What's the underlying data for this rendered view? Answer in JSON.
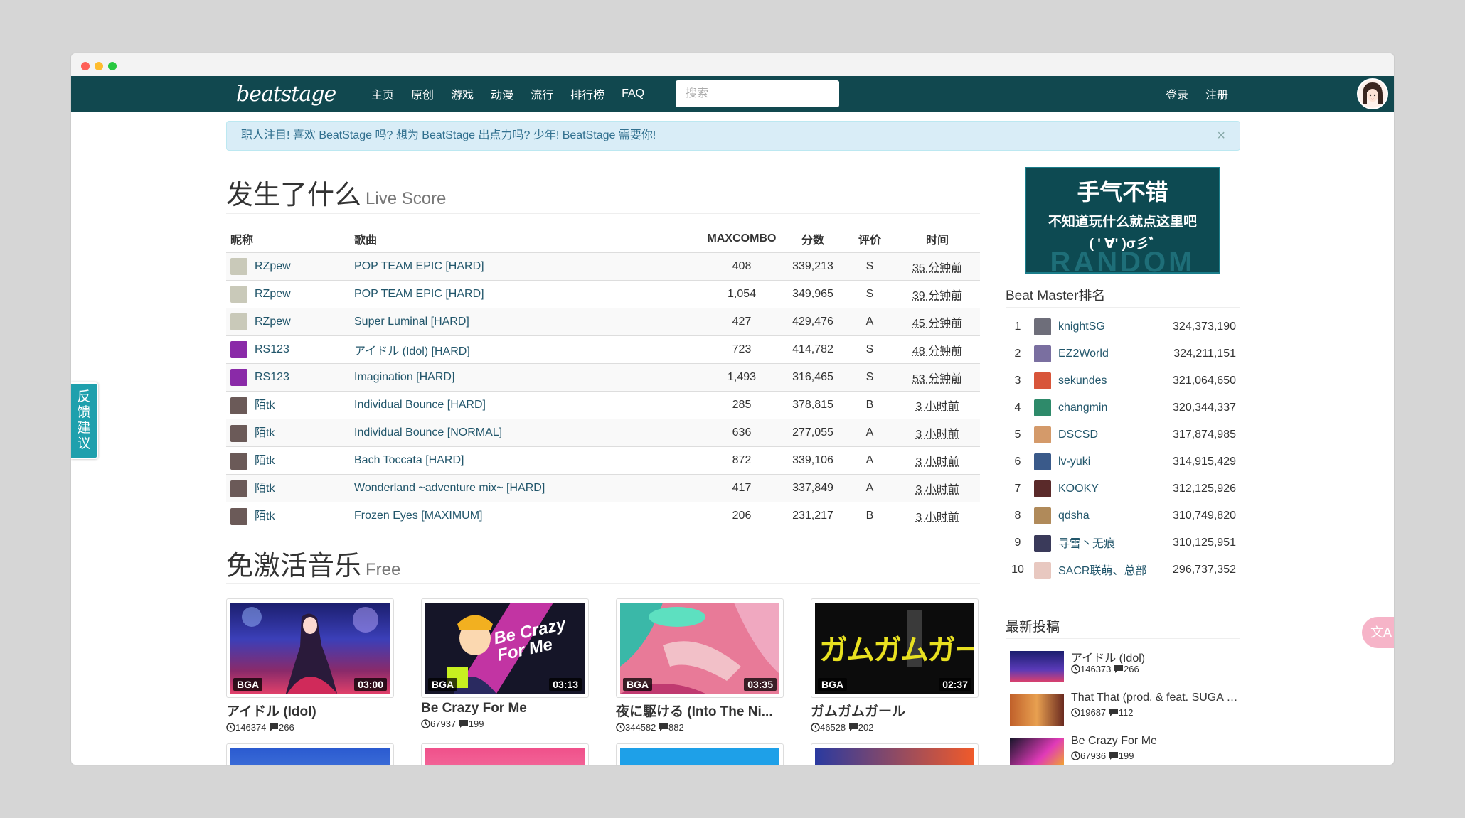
{
  "nav": {
    "logo": "beatstage",
    "items": [
      "主页",
      "原创",
      "游戏",
      "动漫",
      "流行",
      "排行榜",
      "FAQ"
    ],
    "search_placeholder": "搜索",
    "login": "登录",
    "register": "注册"
  },
  "alert": {
    "text": "职人注目! 喜欢 BeatStage 吗? 想为 BeatStage 出点力吗? 少年! BeatStage 需要你!",
    "close": "×"
  },
  "live": {
    "title": "发生了什么",
    "subtitle": "Live Score",
    "headers": [
      "昵称",
      "歌曲",
      "MAXCOMBO",
      "分数",
      "评价",
      "时间"
    ],
    "rows": [
      {
        "user": "RZpew",
        "song": "POP TEAM EPIC [HARD]",
        "combo": "408",
        "score": "339,213",
        "grade": "S",
        "time": "35 分钟前",
        "avatar": "#c9c9b9"
      },
      {
        "user": "RZpew",
        "song": "POP TEAM EPIC [HARD]",
        "combo": "1,054",
        "score": "349,965",
        "grade": "S",
        "time": "39 分钟前",
        "avatar": "#c9c9b9"
      },
      {
        "user": "RZpew",
        "song": "Super Luminal [HARD]",
        "combo": "427",
        "score": "429,476",
        "grade": "A",
        "time": "45 分钟前",
        "avatar": "#c9c9b9"
      },
      {
        "user": "RS123",
        "song": "アイドル (Idol) [HARD]",
        "combo": "723",
        "score": "414,782",
        "grade": "S",
        "time": "48 分钟前",
        "avatar": "#8a2aa8"
      },
      {
        "user": "RS123",
        "song": "Imagination [HARD]",
        "combo": "1,493",
        "score": "316,465",
        "grade": "S",
        "time": "53 分钟前",
        "avatar": "#8a2aa8"
      },
      {
        "user": "陌tk",
        "song": "Individual Bounce [HARD]",
        "combo": "285",
        "score": "378,815",
        "grade": "B",
        "time": "3 小时前",
        "avatar": "#6b5a58"
      },
      {
        "user": "陌tk",
        "song": "Individual Bounce [NORMAL]",
        "combo": "636",
        "score": "277,055",
        "grade": "A",
        "time": "3 小时前",
        "avatar": "#6b5a58"
      },
      {
        "user": "陌tk",
        "song": "Bach Toccata [HARD]",
        "combo": "872",
        "score": "339,106",
        "grade": "A",
        "time": "3 小时前",
        "avatar": "#6b5a58"
      },
      {
        "user": "陌tk",
        "song": "Wonderland ~adventure mix~ [HARD]",
        "combo": "417",
        "score": "337,849",
        "grade": "A",
        "time": "3 小时前",
        "avatar": "#6b5a58"
      },
      {
        "user": "陌tk",
        "song": "Frozen Eyes [MAXIMUM]",
        "combo": "206",
        "score": "231,217",
        "grade": "B",
        "time": "3 小时前",
        "avatar": "#6b5a58"
      }
    ]
  },
  "free": {
    "title": "免激活音乐",
    "subtitle": "Free",
    "cards": [
      {
        "title": "アイドル (Idol)",
        "plays": "146374",
        "comments": "266",
        "badge": "BGA",
        "duration": "03:00"
      },
      {
        "title": "Be Crazy For Me",
        "plays": "67937",
        "comments": "199",
        "badge": "BGA",
        "duration": "03:13",
        "art_text": "Be Crazy For Me"
      },
      {
        "title": "夜に駆ける (Into The Ni...",
        "plays": "344582",
        "comments": "882",
        "badge": "BGA",
        "duration": "03:35"
      },
      {
        "title": "ガムガムガール",
        "plays": "46528",
        "comments": "202",
        "badge": "BGA",
        "duration": "02:37",
        "art_text": "ガムガムガール"
      }
    ]
  },
  "random": {
    "line1": "手气不错",
    "line2": "不知道玩什么就点这里吧",
    "line3": "( ' ∀' )σ彡ﾞ",
    "line4": "RANDOM"
  },
  "ranking": {
    "title": "Beat Master排名",
    "rows": [
      {
        "rank": "1",
        "name": "knightSG",
        "score": "324,373,190",
        "avatar": "#6e6e7a"
      },
      {
        "rank": "2",
        "name": "EZ2World",
        "score": "324,211,151",
        "avatar": "#7a6fa0"
      },
      {
        "rank": "3",
        "name": "sekundes",
        "score": "321,064,650",
        "avatar": "#d8553a"
      },
      {
        "rank": "4",
        "name": "changmin",
        "score": "320,344,337",
        "avatar": "#2e8a6a"
      },
      {
        "rank": "5",
        "name": "DSCSD",
        "score": "317,874,985",
        "avatar": "#d49a6a"
      },
      {
        "rank": "6",
        "name": "lv-yuki",
        "score": "314,915,429",
        "avatar": "#3a5a8a"
      },
      {
        "rank": "7",
        "name": "KOOKY",
        "score": "312,125,926",
        "avatar": "#5a2a2a"
      },
      {
        "rank": "8",
        "name": "qdsha",
        "score": "310,749,820",
        "avatar": "#b08a5a"
      },
      {
        "rank": "9",
        "name": "寻雪丶无痕",
        "score": "310,125,951",
        "avatar": "#3a3a5a"
      },
      {
        "rank": "10",
        "name": "SACR联萌、总部",
        "score": "296,737,352",
        "avatar": "#e8c8c0"
      }
    ]
  },
  "latest": {
    "title": "最新投稿",
    "posts": [
      {
        "title": "アイドル (Idol)",
        "plays": "146373",
        "comments": "266"
      },
      {
        "title": "That That (prod. & feat. SUGA of BTS)",
        "plays": "19687",
        "comments": "112"
      },
      {
        "title": "Be Crazy For Me",
        "plays": "67936",
        "comments": "199"
      }
    ]
  },
  "feedback": "反馈建议",
  "translate_icon": "translate-icon"
}
